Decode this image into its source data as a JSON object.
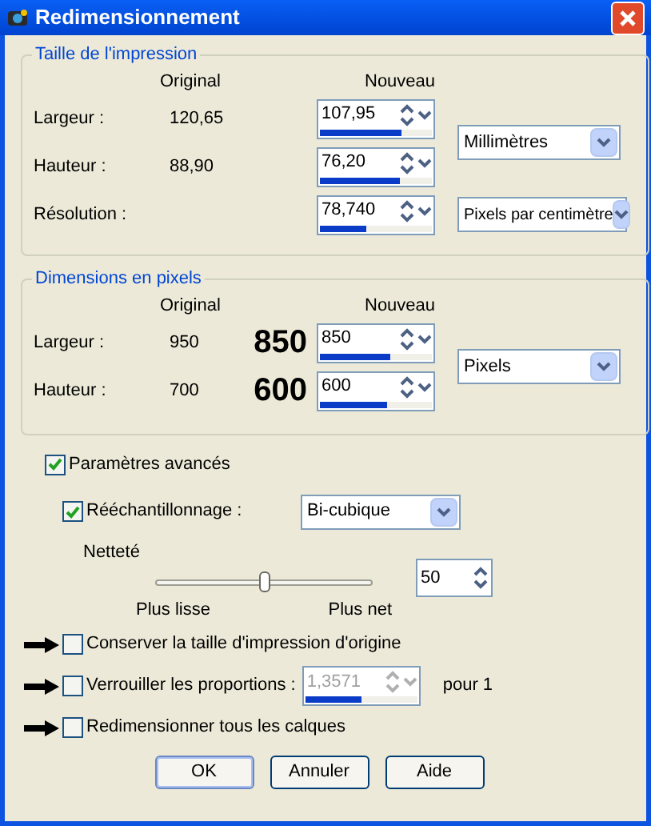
{
  "window": {
    "title": "Redimensionnement"
  },
  "print_size": {
    "title": "Taille de l'impression",
    "col_original": "Original",
    "col_new": "Nouveau",
    "unit": "Millimètres",
    "resolution_unit": "Pixels par centimètre",
    "rows": [
      {
        "label": "Largeur :",
        "original": "120,65",
        "value": "107,95",
        "level": 0.73
      },
      {
        "label": "Hauteur :",
        "original": "88,90",
        "value": "76,20",
        "level": 0.72
      },
      {
        "label": "Résolution :",
        "original": "",
        "value": "78,740",
        "level": 0.41
      }
    ]
  },
  "pixel_size": {
    "title": "Dimensions en pixels",
    "col_original": "Original",
    "col_new": "Nouveau",
    "unit": "Pixels",
    "rows": [
      {
        "label": "Largeur :",
        "original": "950",
        "annotation": "850",
        "value": "850",
        "level": 0.63
      },
      {
        "label": "Hauteur :",
        "original": "700",
        "annotation": "600",
        "value": "600",
        "level": 0.6
      }
    ]
  },
  "advanced": {
    "label": "Paramètres avancés",
    "checked": true
  },
  "resample": {
    "label": "Rééchantillonnage :",
    "checked": true,
    "method": "Bi-cubique"
  },
  "sharpness": {
    "label": "Netteté",
    "level": 0.5,
    "min_label": "Plus lisse",
    "max_label": "Plus net",
    "value": "50"
  },
  "options": [
    {
      "kind": "check",
      "label": "Conserver la taille d'impression d'origine",
      "checked": false,
      "arrow": true
    },
    {
      "kind": "ratio",
      "label": "Verrouiller les proportions :",
      "checked": false,
      "arrow": true,
      "ratio": {
        "value": "1,3571",
        "level": 0.5,
        "disabled": true,
        "suffix": "pour 1"
      }
    },
    {
      "kind": "check",
      "label": "Redimensionner tous les calques",
      "checked": false,
      "arrow": true
    }
  ],
  "buttons": [
    {
      "label": "OK",
      "default": true
    },
    {
      "label": "Annuler",
      "default": false
    },
    {
      "label": "Aide",
      "default": false
    }
  ]
}
